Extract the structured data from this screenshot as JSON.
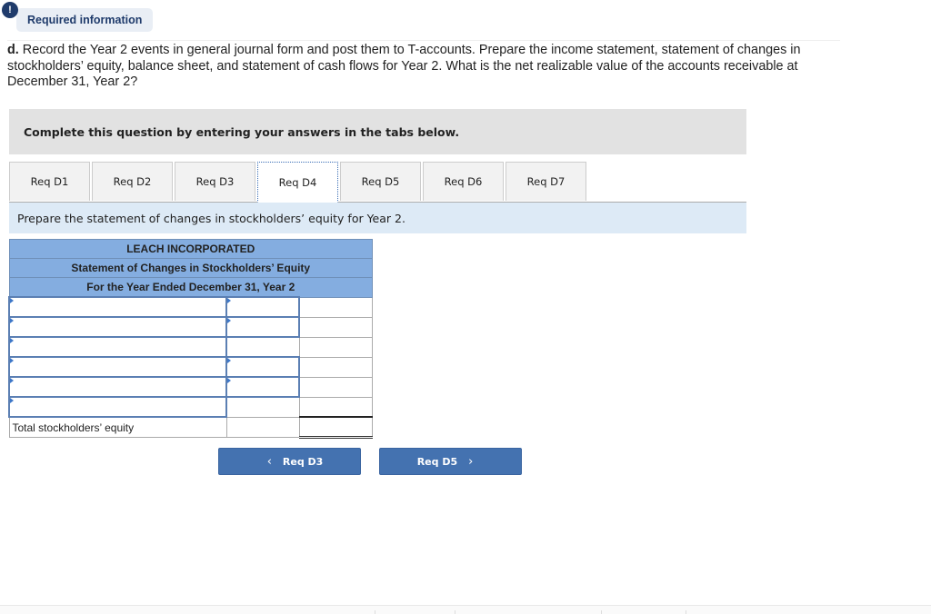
{
  "header": {
    "alert_icon": "!",
    "required_label": "Required information"
  },
  "question": {
    "prefix": "d.",
    "text": " Record the Year 2 events in general journal form and post them to T-accounts. Prepare the income statement, statement of changes in stockholders’ equity, balance sheet, and statement of cash flows for Year 2. What is the net realizable value of the accounts receivable at December 31, Year 2?"
  },
  "instructions": "Complete this question by entering your answers in the tabs below.",
  "tabs": [
    {
      "label": "Req D1",
      "active": false
    },
    {
      "label": "Req D2",
      "active": false
    },
    {
      "label": "Req D3",
      "active": false
    },
    {
      "label": "Req D4",
      "active": true
    },
    {
      "label": "Req D5",
      "active": false
    },
    {
      "label": "Req D6",
      "active": false
    },
    {
      "label": "Req D7",
      "active": false
    }
  ],
  "prompt": "Prepare the statement of changes in stockholders’ equity for Year 2.",
  "statement": {
    "company": "LEACH INCORPORATED",
    "title": "Statement of Changes in Stockholders’ Equity",
    "period": "For the Year Ended December 31, Year 2",
    "rows": [
      {
        "label": "",
        "amount1": "",
        "amount2": ""
      },
      {
        "label": "",
        "amount1": "",
        "amount2": ""
      },
      {
        "label": "",
        "amount1": "",
        "amount2": ""
      },
      {
        "label": "",
        "amount1": "",
        "amount2": ""
      },
      {
        "label": "",
        "amount1": "",
        "amount2": ""
      },
      {
        "label": "",
        "amount1": "",
        "amount2": ""
      }
    ],
    "total_label": "Total stockholders’ equity",
    "total_amount1": "",
    "total_amount2": ""
  },
  "nav": {
    "prev_label": "Req D3",
    "prev_icon": "‹",
    "next_label": "Req D5",
    "next_icon": "›"
  }
}
